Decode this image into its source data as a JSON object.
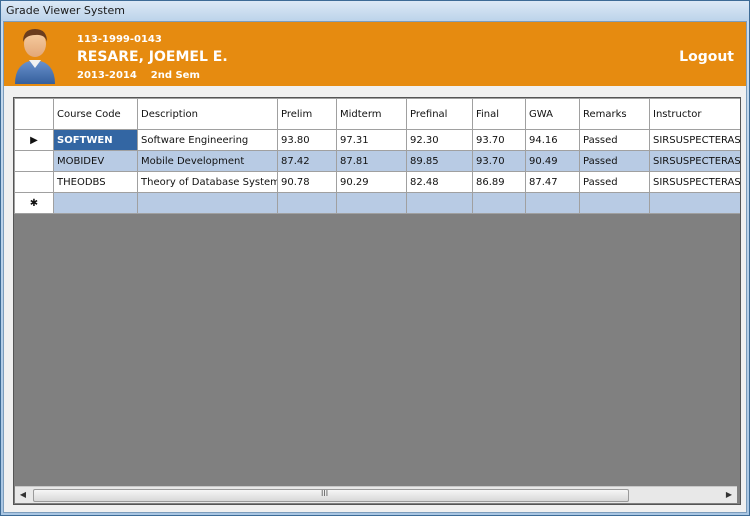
{
  "window": {
    "title": "Grade Viewer System"
  },
  "header": {
    "student_id": "113-1999-0143",
    "student_name": "RESARE, JOEMEL E.",
    "term": "2013-2014    2nd Sem",
    "logout_label": "Logout",
    "accent_color": "#e68b10"
  },
  "grid": {
    "columns": [
      "Course Code",
      "Description",
      "Prelim",
      "Midterm",
      "Prefinal",
      "Final",
      "GWA",
      "Remarks",
      "Instructor"
    ],
    "rows": [
      {
        "code": "SOFTWEN",
        "description": "Software Engineering",
        "prelim": "93.80",
        "midterm": "97.31",
        "prefinal": "92.30",
        "final": "93.70",
        "gwa": "94.16",
        "remarks": "Passed",
        "instructor": "SIRSUSPECTERASE"
      },
      {
        "code": "MOBIDEV",
        "description": "Mobile Development",
        "prelim": "87.42",
        "midterm": "87.81",
        "prefinal": "89.85",
        "final": "93.70",
        "gwa": "90.49",
        "remarks": "Passed",
        "instructor": "SIRSUSPECTERASE"
      },
      {
        "code": "THEODBS",
        "description": "Theory of Database Systems",
        "prelim": "90.78",
        "midterm": "90.29",
        "prefinal": "82.48",
        "final": "86.89",
        "gwa": "87.47",
        "remarks": "Passed",
        "instructor": "SIRSUSPECTERASE"
      }
    ],
    "current_row_marker": "▶",
    "new_row_marker": "✱",
    "selected_cell_color": "#3366a3"
  },
  "scrollbar": {
    "grip": "III"
  }
}
